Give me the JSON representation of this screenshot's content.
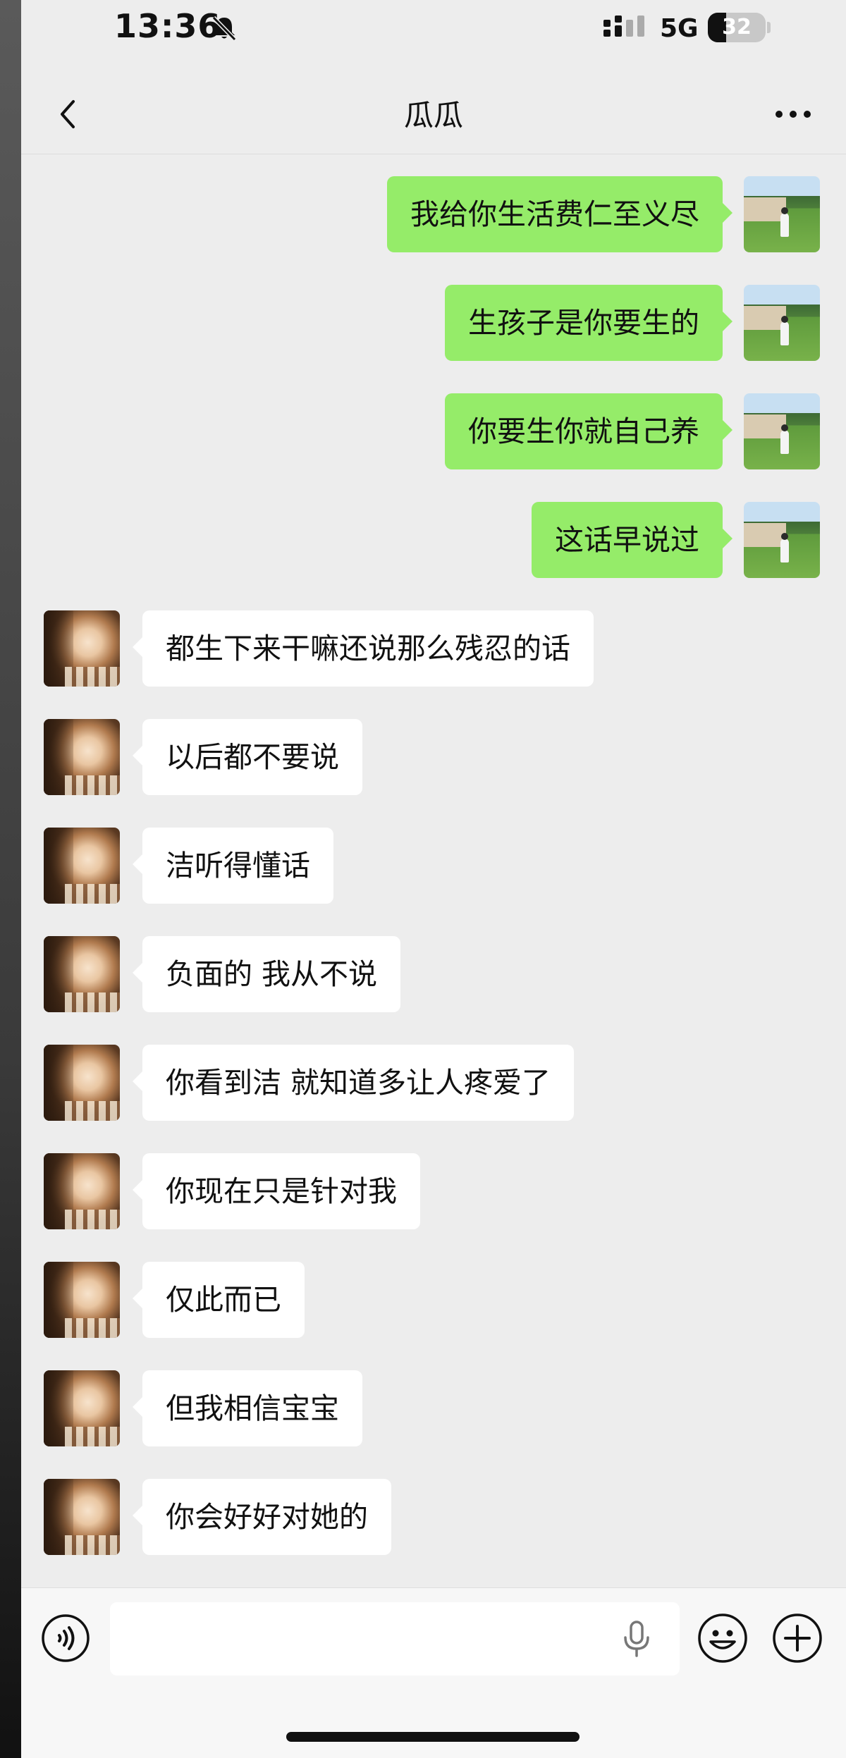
{
  "status_bar": {
    "time": "13:36",
    "network": "5G",
    "battery": "32",
    "battery_level": 0.32,
    "icons": [
      "bell-off-icon",
      "signal-icon"
    ]
  },
  "nav": {
    "title": "瓜瓜",
    "back_icon": "chevron-left-icon",
    "more_icon": "more-icon"
  },
  "messages": [
    {
      "side": "sent",
      "text": "我给你生活费仁至义尽"
    },
    {
      "side": "sent",
      "text": "生孩子是你要生的"
    },
    {
      "side": "sent",
      "text": "你要生你就自己养"
    },
    {
      "side": "sent",
      "text": "这话早说过"
    },
    {
      "side": "recv",
      "text": "都生下来干嘛还说那么残忍的话"
    },
    {
      "side": "recv",
      "text": "以后都不要说"
    },
    {
      "side": "recv",
      "text": "洁听得懂话"
    },
    {
      "side": "recv",
      "text": "负面的 我从不说"
    },
    {
      "side": "recv",
      "text": "你看到洁 就知道多让人疼爱了"
    },
    {
      "side": "recv",
      "text": "你现在只是针对我"
    },
    {
      "side": "recv",
      "text": "仅此而已"
    },
    {
      "side": "recv",
      "text": "但我相信宝宝"
    },
    {
      "side": "recv",
      "text": "你会好好对她的"
    }
  ],
  "input_bar": {
    "value": "",
    "icons": [
      "voice-icon",
      "mic-icon",
      "emoji-icon",
      "plus-icon"
    ]
  },
  "colors": {
    "sent_bubble": "#95ec69",
    "recv_bubble": "#ffffff",
    "background": "#ededed"
  }
}
